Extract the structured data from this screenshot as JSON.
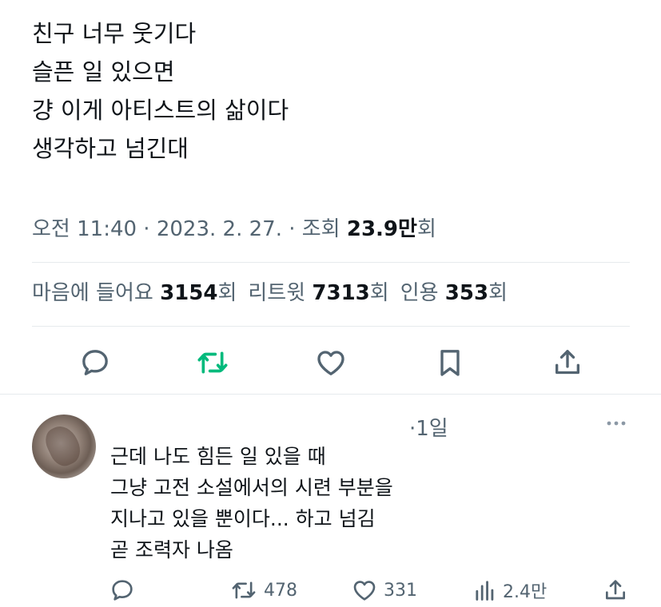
{
  "tweet": {
    "lines": [
      "친구 너무 웃기다",
      "슬픈 일 있으면",
      "걍 이게 아티스트의 삶이다",
      "생각하고 넘긴대"
    ],
    "time": "오전 11:40",
    "sep1": " · ",
    "date": "2023. 2. 27.",
    "sep2": " · ",
    "views_label": "조회 ",
    "views_count": "23.9만",
    "views_suffix": "회"
  },
  "stats": {
    "likes_label": "마음에 들어요 ",
    "likes_count": "3154",
    "likes_suffix": "회",
    "retweets_label": "리트윗 ",
    "retweets_count": "7313",
    "retweets_suffix": "회",
    "quotes_label": "인용 ",
    "quotes_count": "353",
    "quotes_suffix": "회"
  },
  "actions": [
    "reply-icon",
    "retweet-icon",
    "like-icon",
    "bookmark-icon",
    "share-icon"
  ],
  "reply": {
    "time": "·1일",
    "lines": [
      "근데 나도 힘든 일 있을 때",
      "그냥 고전 소설에서의 시련 부분을",
      "지나고 있을 뿐이다... 하고 넘김",
      "곧 조력자 나옴"
    ],
    "retweets": "478",
    "likes": "331",
    "views": "2.4만"
  },
  "colors": {
    "text": "#0f1419",
    "secondary": "#536471",
    "retweet_green": "#00ba7c",
    "divider": "#e6eaed"
  }
}
